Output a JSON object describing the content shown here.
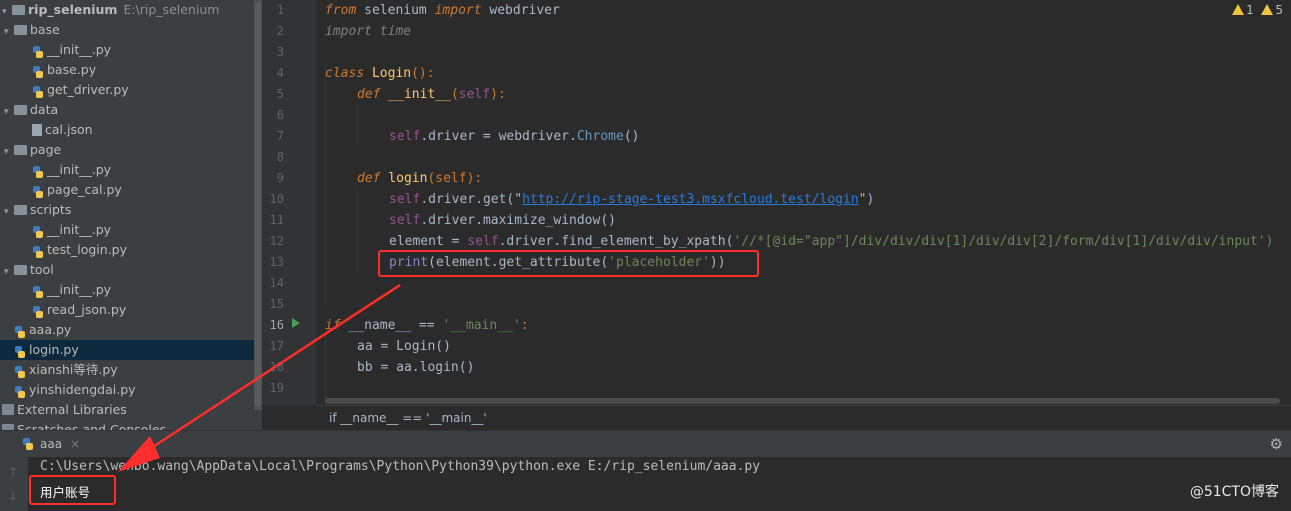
{
  "project": {
    "root_name": "rip_selenium",
    "root_path": "E:\\rip_selenium",
    "items": [
      {
        "label": "base",
        "type": "folder",
        "level": 1
      },
      {
        "label": "__init__.py",
        "type": "py",
        "level": 2
      },
      {
        "label": "base.py",
        "type": "py",
        "level": 2
      },
      {
        "label": "get_driver.py",
        "type": "py",
        "level": 2
      },
      {
        "label": "data",
        "type": "folder",
        "level": 1
      },
      {
        "label": "cal.json",
        "type": "json",
        "level": 2
      },
      {
        "label": "page",
        "type": "folder",
        "level": 1
      },
      {
        "label": "__init__.py",
        "type": "py",
        "level": 2
      },
      {
        "label": "page_cal.py",
        "type": "py",
        "level": 2
      },
      {
        "label": "scripts",
        "type": "folder",
        "level": 1
      },
      {
        "label": "__init__.py",
        "type": "py",
        "level": 2
      },
      {
        "label": "test_login.py",
        "type": "py",
        "level": 2
      },
      {
        "label": "tool",
        "type": "folder",
        "level": 1
      },
      {
        "label": "__init__.py",
        "type": "py",
        "level": 2
      },
      {
        "label": "read_json.py",
        "type": "py",
        "level": 2
      },
      {
        "label": "aaa.py",
        "type": "py",
        "level": 1
      },
      {
        "label": "login.py",
        "type": "py",
        "level": 1,
        "selected": true
      },
      {
        "label": "xianshi等待.py",
        "type": "py",
        "level": 1
      },
      {
        "label": "yinshidengdai.py",
        "type": "py",
        "level": 1
      },
      {
        "label": "External Libraries",
        "type": "lib",
        "level": 0
      },
      {
        "label": "Scratches and Consoles",
        "type": "scratch",
        "level": 0
      }
    ]
  },
  "editor": {
    "warning_count_a": "1",
    "warning_count_b": "5",
    "line_numbers": [
      "1",
      "2",
      "3",
      "4",
      "5",
      "6",
      "7",
      "8",
      "9",
      "10",
      "11",
      "12",
      "13",
      "14",
      "15",
      "16",
      "17",
      "18",
      "19"
    ],
    "current_line": "16",
    "code": {
      "l1_a": "from",
      "l1_b": " selenium ",
      "l1_c": "import",
      "l1_d": " webdriver",
      "l2": "import time",
      "l4_a": "class",
      "l4_b": " Login",
      "l4_c": "():",
      "l5_a": "def",
      "l5_b": " __init__",
      "l5_c": "(",
      "l5_d": "self",
      "l5_e": "):",
      "l7_a": "self",
      "l7_b": ".driver = webdriver.",
      "l7_c": "Chrome",
      "l7_d": "()",
      "l9_a": "def",
      "l9_b": " login",
      "l9_c": "(self):",
      "l10_a": "self",
      "l10_b": ".driver.",
      "l10_c": "get",
      "l10_d": "(\"",
      "l10_e": "http://rip-stage-test3.msxfcloud.test/login",
      "l10_f": "\")",
      "l11_a": "self",
      "l11_b": ".driver.",
      "l11_c": "maximize_window",
      "l11_d": "()",
      "l12_a": "element = ",
      "l12_b": "self",
      "l12_c": ".driver.",
      "l12_d": "find_element_by_xpath",
      "l12_e": "(",
      "l12_f": "'//*[@id=\"app\"]/div/div/div[1]/div/div[2]/form/div[1]/div/div/input')",
      "l13_a": "print",
      "l13_b": "(element.",
      "l13_c": "get_attribute",
      "l13_d": "(",
      "l13_e": "'placeholder'",
      "l13_f": "))",
      "l16_a": "if",
      "l16_b": " __name__ == ",
      "l16_c": "'__main__'",
      "l16_d": ":",
      "l17_a": "aa = ",
      "l17_b": "Login",
      "l17_c": "()",
      "l18_a": "bb = aa.",
      "l18_b": "login",
      "l18_c": "()"
    },
    "breadcrumb": "if __name__ == '__main__'"
  },
  "run": {
    "tab_label": "aaa",
    "command": "C:\\Users\\wenbo.wang\\AppData\\Local\\Programs\\Python\\Python39\\python.exe E:/rip_selenium/aaa.py",
    "output": "用户账号"
  },
  "watermark": "@51CTO博客",
  "colors": {
    "annotation": "#ff2d2d",
    "keyword": "#cc7832",
    "string": "#6a8759",
    "self": "#94558d"
  }
}
